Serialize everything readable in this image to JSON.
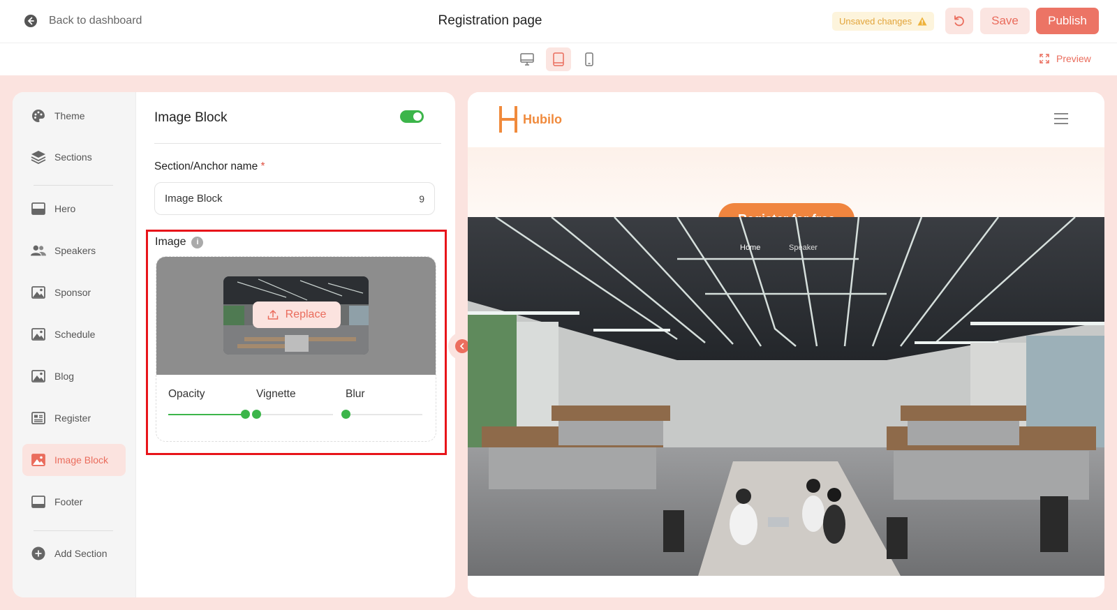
{
  "topbar": {
    "back_label": "Back to dashboard",
    "page_title": "Registration page",
    "unsaved_label": "Unsaved changes",
    "save_label": "Save",
    "publish_label": "Publish"
  },
  "subbar": {
    "devices": [
      "desktop-icon",
      "tablet-icon",
      "mobile-icon"
    ],
    "active_device": "tablet",
    "preview_label": "Preview"
  },
  "sidebar": {
    "items": [
      {
        "label": "Theme",
        "icon": "palette-icon"
      },
      {
        "label": "Sections",
        "icon": "layers-icon"
      },
      {
        "label": "Hero",
        "icon": "hero-icon"
      },
      {
        "label": "Speakers",
        "icon": "people-icon"
      },
      {
        "label": "Sponsor",
        "icon": "image-icon"
      },
      {
        "label": "Schedule",
        "icon": "image-icon"
      },
      {
        "label": "Blog",
        "icon": "image-icon"
      },
      {
        "label": "Register",
        "icon": "form-icon"
      },
      {
        "label": "Image Block",
        "icon": "image-icon",
        "active": true
      },
      {
        "label": "Footer",
        "icon": "footer-icon"
      },
      {
        "label": "Add Section",
        "icon": "plus-circle-icon"
      }
    ]
  },
  "editor": {
    "title": "Image Block",
    "enabled": true,
    "anchor_label": "Section/Anchor name",
    "required_mark": "*",
    "anchor_value": "Image Block",
    "anchor_count": "9",
    "image_label": "Image",
    "info_glyph": "i",
    "replace_label": "Replace",
    "sliders": [
      {
        "label": "Opacity",
        "value": 1.0
      },
      {
        "label": "Vignette",
        "value": 0.0
      },
      {
        "label": "Blur",
        "value": 0.0
      }
    ]
  },
  "preview": {
    "logo_text": "Hubilo",
    "register_label": "Register for free",
    "photo_nav": [
      "Home",
      "Speaker"
    ]
  },
  "colors": {
    "accent": "#ec7465",
    "accent_light": "#fbe3df",
    "toggle_green": "#3cb54a",
    "brand_orange": "#f0853f",
    "highlight_red": "#e8141a"
  }
}
